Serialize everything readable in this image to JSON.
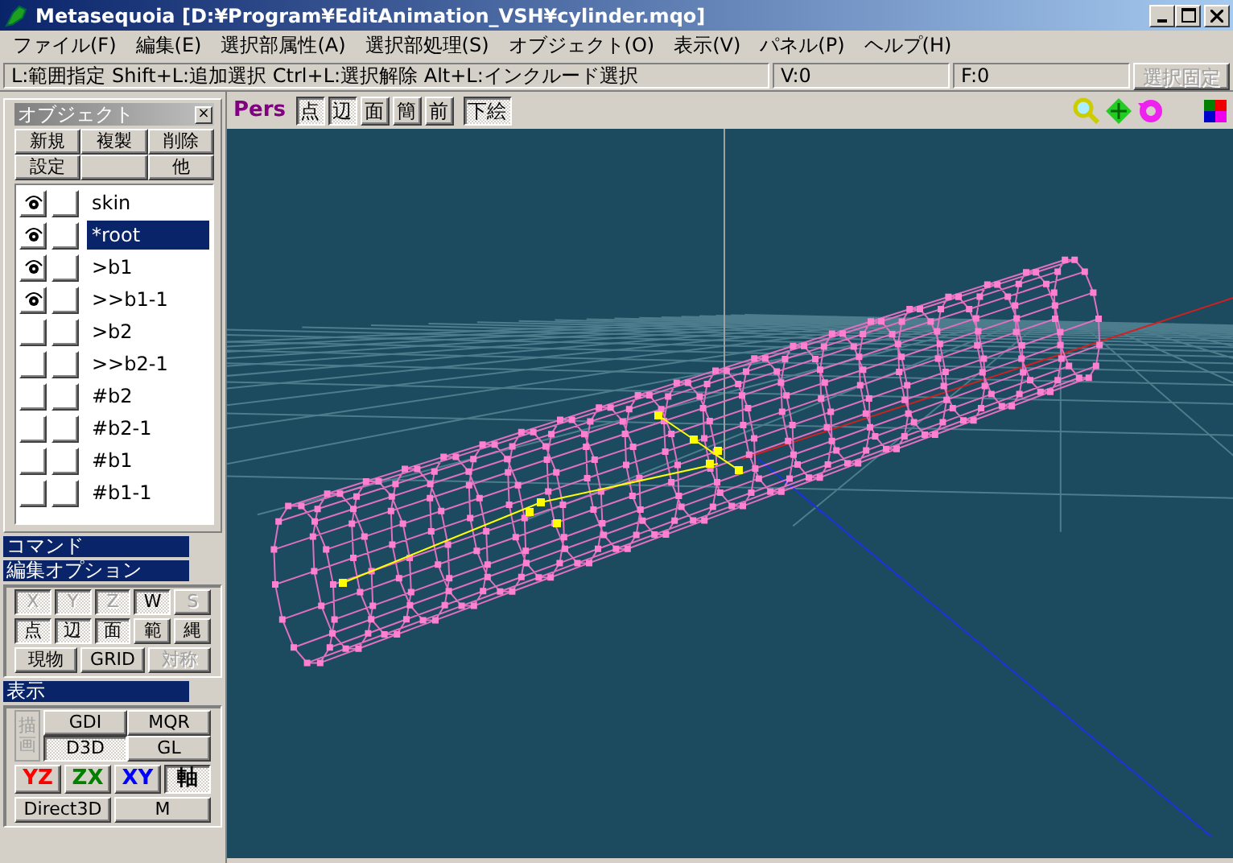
{
  "window": {
    "title": "Metasequoia [D:¥Program¥EditAnimation_VSH¥cylinder.mqo]"
  },
  "menu": [
    "ファイル(F)",
    "編集(E)",
    "選択部属性(A)",
    "選択部処理(S)",
    "オブジェクト(O)",
    "表示(V)",
    "パネル(P)",
    "ヘルプ(H)"
  ],
  "status_bar": {
    "hint": "L:範囲指定  Shift+L:追加選択  Ctrl+L:選択解除  Alt+L:インクルード選択",
    "vertices": "V:0",
    "faces": "F:0",
    "lock_button": {
      "label": "選択固定",
      "disabled": true
    }
  },
  "object_panel": {
    "title": "オブジェクト",
    "close": "×",
    "buttons": [
      {
        "label": "新規"
      },
      {
        "label": "複製"
      },
      {
        "label": "削除"
      },
      {
        "label": "設定"
      },
      {
        "label": "他"
      }
    ],
    "items": [
      {
        "name": "skin",
        "visible": true,
        "locked": false,
        "selected": false
      },
      {
        "name": "*root",
        "visible": true,
        "locked": false,
        "selected": true
      },
      {
        "name": ">b1",
        "visible": true,
        "locked": false,
        "selected": false
      },
      {
        "name": ">>b1-1",
        "visible": true,
        "locked": false,
        "selected": false
      },
      {
        "name": ">b2",
        "visible": false,
        "locked": false,
        "selected": false
      },
      {
        "name": ">>b2-1",
        "visible": false,
        "locked": false,
        "selected": false
      },
      {
        "name": "#b2",
        "visible": false,
        "locked": false,
        "selected": false
      },
      {
        "name": "#b2-1",
        "visible": false,
        "locked": false,
        "selected": false
      },
      {
        "name": "#b1",
        "visible": false,
        "locked": false,
        "selected": false
      },
      {
        "name": "#b1-1",
        "visible": false,
        "locked": false,
        "selected": false
      }
    ]
  },
  "command_panel": {
    "title": "コマンド"
  },
  "edit_options": {
    "title": "編集オプション",
    "axis_buttons": [
      {
        "label": "X",
        "pressed": true,
        "disabled": true
      },
      {
        "label": "Y",
        "pressed": true,
        "disabled": true
      },
      {
        "label": "Z",
        "pressed": true,
        "disabled": true
      },
      {
        "label": "W",
        "pressed": true,
        "disabled": false
      },
      {
        "label": "S",
        "pressed": false,
        "disabled": true
      }
    ],
    "element_buttons": [
      {
        "label": "点",
        "pressed": true,
        "disabled": false
      },
      {
        "label": "辺",
        "pressed": true,
        "disabled": false
      },
      {
        "label": "面",
        "pressed": true,
        "disabled": false
      },
      {
        "label": "範",
        "pressed": false,
        "disabled": false
      },
      {
        "label": "縄",
        "pressed": false,
        "disabled": false
      }
    ],
    "mode_buttons": [
      {
        "label": "現物",
        "pressed": false,
        "disabled": false
      },
      {
        "label": "GRID",
        "pressed": false,
        "disabled": false
      },
      {
        "label": "対称",
        "pressed": false,
        "disabled": true
      }
    ]
  },
  "display_panel": {
    "title": "表示",
    "draw_label": {
      "label": "描画",
      "disabled": true
    },
    "renderers": [
      {
        "label": "GDI",
        "pressed": false
      },
      {
        "label": "MQR",
        "pressed": false
      },
      {
        "label": "D3D",
        "pressed": true
      },
      {
        "label": "GL",
        "pressed": false
      }
    ],
    "views": [
      {
        "label": "YZ",
        "pressed": false,
        "color": "#ff0000"
      },
      {
        "label": "ZX",
        "pressed": false,
        "color": "#008000"
      },
      {
        "label": "XY",
        "pressed": false,
        "color": "#0000ff"
      },
      {
        "label": "軸",
        "pressed": true,
        "color": "#000000"
      }
    ],
    "bottom": [
      {
        "label": "Direct3D"
      },
      {
        "label": "M"
      }
    ]
  },
  "viewport": {
    "view": "Pers",
    "buttons": [
      {
        "label": "点",
        "pressed": true
      },
      {
        "label": "辺",
        "pressed": true
      },
      {
        "label": "面",
        "pressed": false
      },
      {
        "label": "簡",
        "pressed": false
      },
      {
        "label": "前",
        "pressed": false
      },
      {
        "label": "下絵",
        "pressed": true
      }
    ]
  }
}
